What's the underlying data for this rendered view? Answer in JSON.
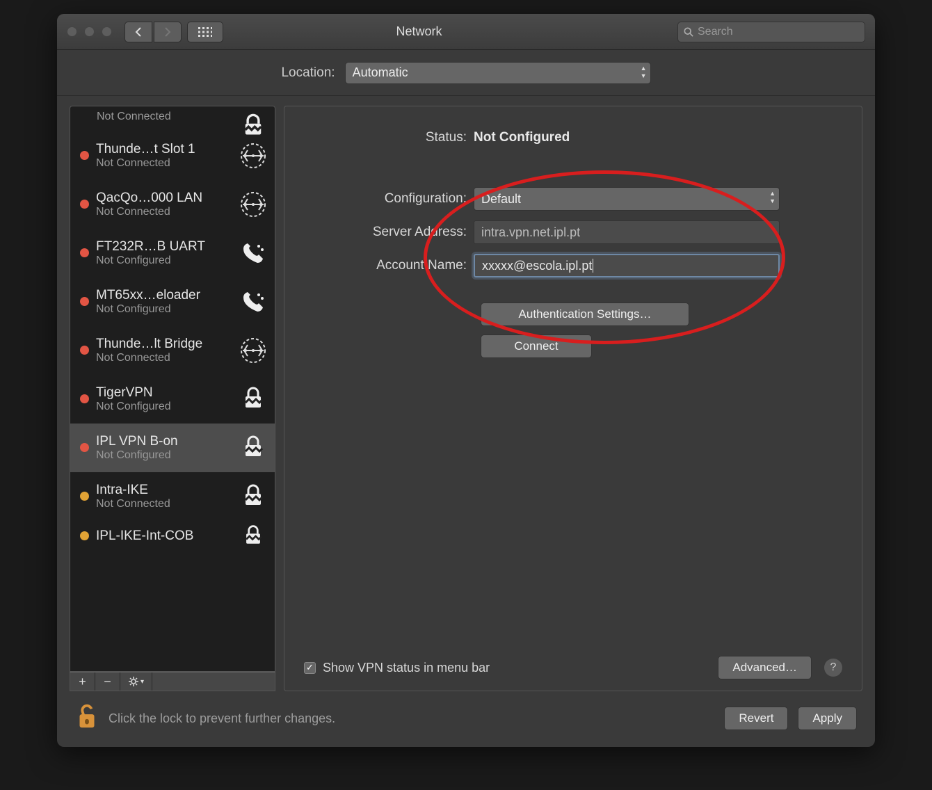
{
  "window": {
    "title": "Network",
    "search_placeholder": "Search"
  },
  "location": {
    "label": "Location:",
    "value": "Automatic"
  },
  "sidebar": {
    "partial_status": "Not Connected",
    "items": [
      {
        "name": "Thunde…t Slot  1",
        "status": "Not Connected",
        "dot": "red",
        "icon": "ethernet"
      },
      {
        "name": "QacQo…000 LAN",
        "status": "Not Connected",
        "dot": "red",
        "icon": "ethernet"
      },
      {
        "name": "FT232R…B UART",
        "status": "Not Configured",
        "dot": "red",
        "icon": "phone"
      },
      {
        "name": "MT65xx…eloader",
        "status": "Not Configured",
        "dot": "red",
        "icon": "phone"
      },
      {
        "name": "Thunde…lt Bridge",
        "status": "Not Connected",
        "dot": "red",
        "icon": "ethernet"
      },
      {
        "name": "TigerVPN",
        "status": "Not Configured",
        "dot": "red",
        "icon": "lock"
      },
      {
        "name": "IPL VPN B-on",
        "status": "Not Configured",
        "dot": "red",
        "icon": "lock",
        "selected": true
      },
      {
        "name": "Intra-IKE",
        "status": "Not Connected",
        "dot": "or",
        "icon": "lock"
      },
      {
        "name": "IPL-IKE-Int-COB",
        "status": "",
        "dot": "or",
        "icon": "lock"
      }
    ]
  },
  "detail": {
    "status_label": "Status:",
    "status_value": "Not Configured",
    "config_label": "Configuration:",
    "config_value": "Default",
    "server_label": "Server Address:",
    "server_value": "intra.vpn.net.ipl.pt",
    "account_label": "Account Name:",
    "account_value": "xxxxx@escola.ipl.pt",
    "auth_button": "Authentication Settings…",
    "connect_button": "Connect",
    "show_status": "Show VPN status in menu bar",
    "advanced": "Advanced…"
  },
  "bottom": {
    "lock_text": "Click the lock to prevent further changes.",
    "revert": "Revert",
    "apply": "Apply"
  }
}
